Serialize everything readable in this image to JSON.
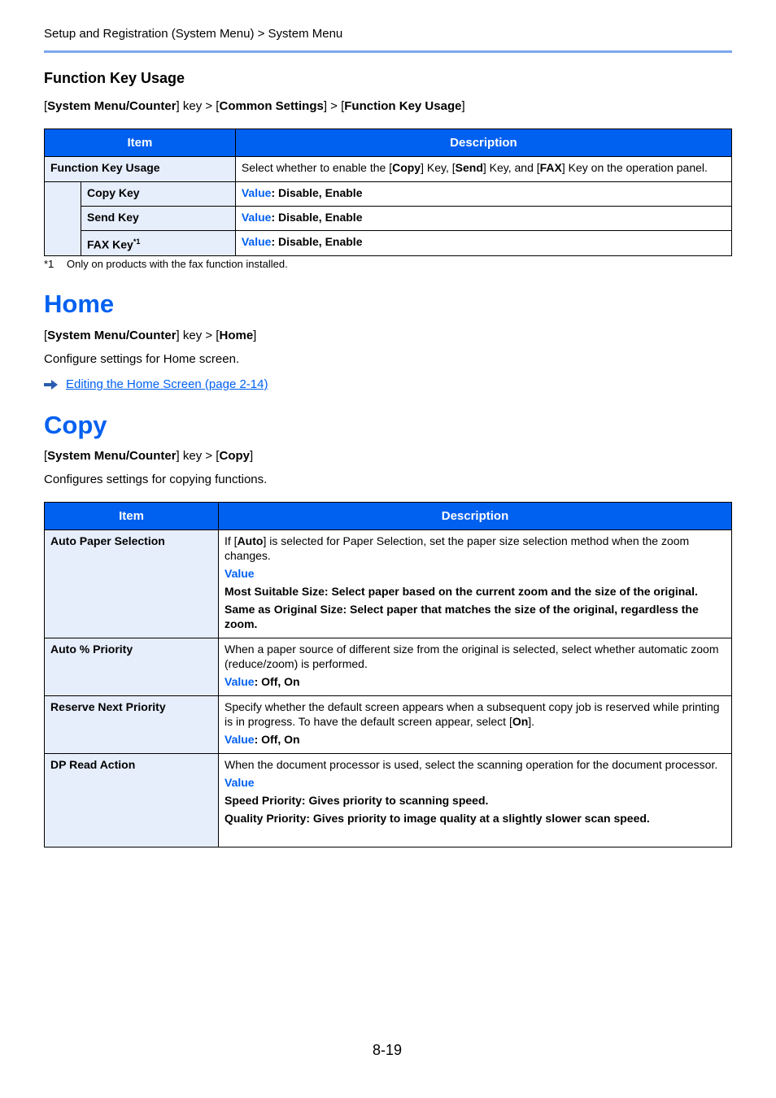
{
  "header": {
    "breadcrumb": "Setup and Registration (System Menu) > System Menu"
  },
  "function_key_usage": {
    "title": "Function Key Usage",
    "path": [
      {
        "t": "[",
        "b": false
      },
      {
        "t": "System Menu/Counter",
        "b": true
      },
      {
        "t": "] key > [",
        "b": false
      },
      {
        "t": "Common Settings",
        "b": true
      },
      {
        "t": "] > [",
        "b": false
      },
      {
        "t": "Function Key Usage",
        "b": true
      },
      {
        "t": "]",
        "b": false
      }
    ],
    "table": {
      "headers": {
        "item": "Item",
        "description": "Description"
      },
      "parent": {
        "item": "Function Key Usage",
        "desc_parts": [
          {
            "t": "Select whether to enable the [",
            "b": false
          },
          {
            "t": "Copy",
            "b": true
          },
          {
            "t": "] Key, [",
            "b": false
          },
          {
            "t": "Send",
            "b": true
          },
          {
            "t": "] Key, and [",
            "b": false
          },
          {
            "t": "FAX",
            "b": true
          },
          {
            "t": "] Key on the operation panel.",
            "b": false
          }
        ]
      },
      "rows": [
        {
          "item": "Copy Key",
          "sup": "",
          "value_label": "Value",
          "value": ": Disable, Enable"
        },
        {
          "item": "Send Key",
          "sup": "",
          "value_label": "Value",
          "value": ": Disable, Enable"
        },
        {
          "item": "FAX Key",
          "sup": "*1",
          "value_label": "Value",
          "value": ": Disable, Enable"
        }
      ]
    },
    "footnote": {
      "mark": "*1",
      "text": "Only on products with the fax function installed."
    }
  },
  "home": {
    "title": "Home",
    "path": [
      {
        "t": "[",
        "b": false
      },
      {
        "t": "System Menu/Counter",
        "b": true
      },
      {
        "t": "] key > [",
        "b": false
      },
      {
        "t": "Home",
        "b": true
      },
      {
        "t": "]",
        "b": false
      }
    ],
    "description": "Configure settings for Home screen.",
    "link": "Editing the Home Screen (page 2-14)"
  },
  "copy": {
    "title": "Copy",
    "path": [
      {
        "t": "[",
        "b": false
      },
      {
        "t": "System Menu/Counter",
        "b": true
      },
      {
        "t": "] key > [",
        "b": false
      },
      {
        "t": "Copy",
        "b": true
      },
      {
        "t": "]",
        "b": false
      }
    ],
    "description": "Configures settings for copying functions.",
    "table": {
      "headers": {
        "item": "Item",
        "description": "Description"
      },
      "rows": [
        {
          "item": "Auto Paper Selection",
          "desc": [
            {
              "t": "If [",
              "b": false
            },
            {
              "t": "Auto",
              "b": true
            },
            {
              "t": "] is selected for Paper Selection, set the paper size selection method when the zoom changes.",
              "b": false
            }
          ],
          "value_label": "Value",
          "value_inline": "",
          "options": [
            "Most Suitable Size: Select paper based on the current zoom and the size of the original.",
            "Same as Original Size: Select paper that matches the size of the original, regardless the zoom."
          ]
        },
        {
          "item": "Auto % Priority",
          "desc": [
            {
              "t": "When a paper source of different size from the original is selected, select whether automatic zoom (reduce/zoom) is performed.",
              "b": false
            }
          ],
          "value_label": "Value",
          "value_inline": ": Off, On",
          "options": []
        },
        {
          "item": "Reserve Next Priority",
          "desc": [
            {
              "t": "Specify whether the default screen appears when a subsequent copy job is reserved while printing is in progress. To have the default screen appear, select [",
              "b": false
            },
            {
              "t": "On",
              "b": true
            },
            {
              "t": "].",
              "b": false
            }
          ],
          "value_label": "Value",
          "value_inline": ": Off, On",
          "options": []
        },
        {
          "item": "DP Read Action",
          "desc": [
            {
              "t": "When the document processor is used, select the scanning operation for the document processor.",
              "b": false
            }
          ],
          "value_label": "Value",
          "value_inline": "",
          "options": [
            "Speed Priority: Gives priority to scanning speed.",
            "Quality Priority: Gives priority to image quality at a slightly slower scan speed."
          ]
        }
      ]
    }
  },
  "footer": {
    "page_number": "8-19"
  },
  "icons": {
    "link_arrow": "right-arrow-icon"
  },
  "colors": {
    "accent": "#0060f0",
    "rule": "#7ba7f0",
    "item_bg": "#e6edfb"
  }
}
